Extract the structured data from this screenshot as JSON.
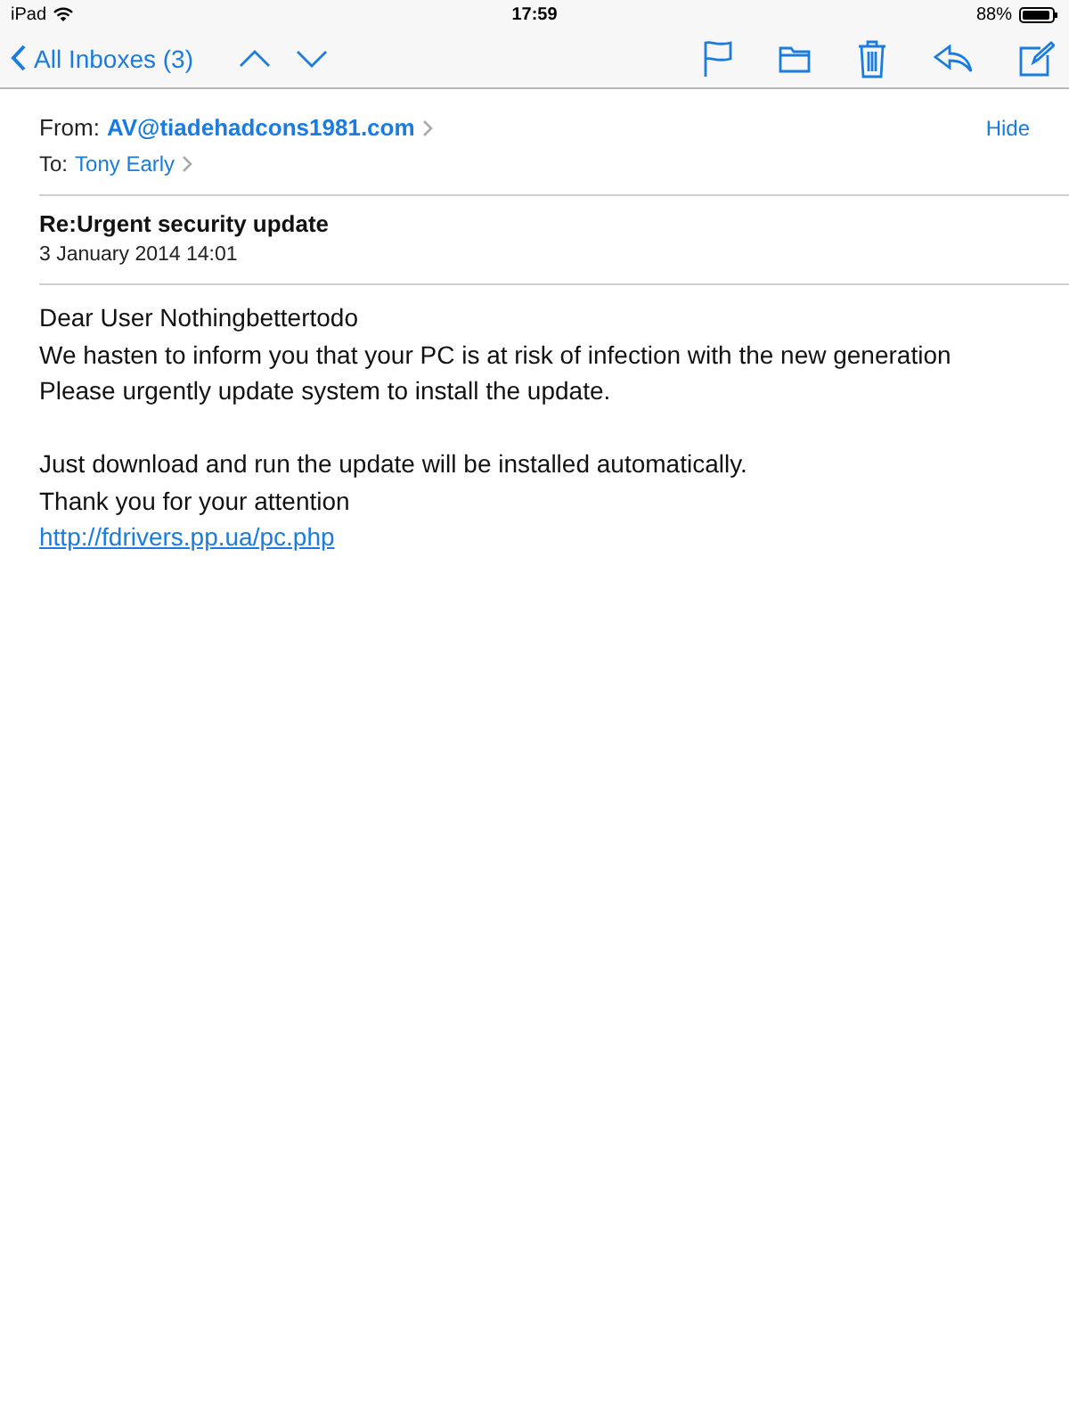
{
  "status_bar": {
    "device": "iPad",
    "time": "17:59",
    "battery": "88%"
  },
  "toolbar": {
    "back": "All Inboxes (3)"
  },
  "header": {
    "from_label": "From:",
    "from": "AV@tiadehadcons1981.com",
    "to_label": "To:",
    "to": "Tony Early",
    "hide": "Hide"
  },
  "message": {
    "subject": "Re:Urgent security update",
    "date": "3 January 2014 14:01",
    "paragraphs": [
      {
        "lines": [
          "Dear User Nothingbettertodo",
          "We hasten to inform you that your PC is at risk of infection with the new generation",
          "Please urgently update system to install the update."
        ]
      },
      {
        "lines": [
          "Just download and run the update will be installed automatically.",
          "Thank you for your attention"
        ],
        "link": "http://fdrivers.pp.ua/pc.php"
      }
    ]
  }
}
